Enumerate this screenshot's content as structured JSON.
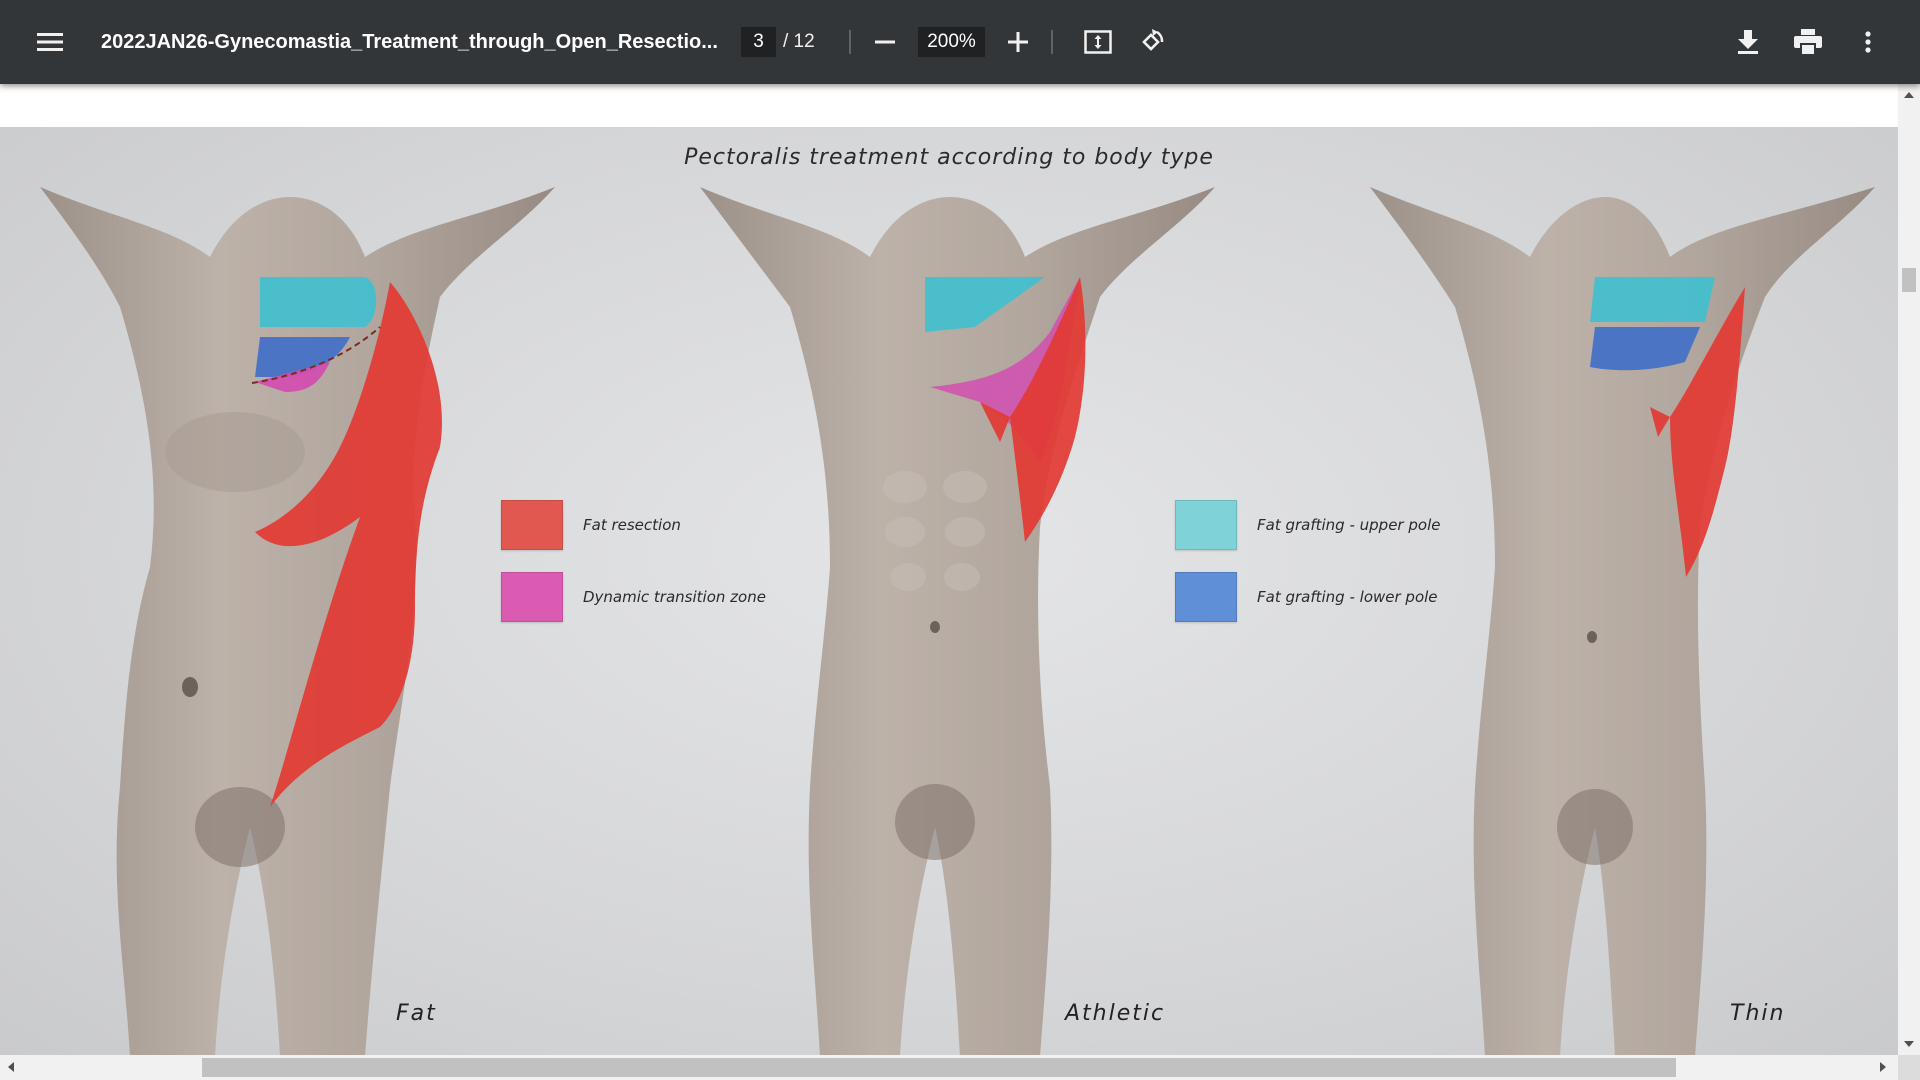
{
  "toolbar": {
    "menu_icon": "hamburger-menu-icon",
    "title": "2022JAN26-Gynecomastia_Treatment_through_Open_Resectio...",
    "current_page": "3",
    "page_total": "/ 12",
    "zoom_out_icon": "minus-icon",
    "zoom_value": "200%",
    "zoom_in_icon": "plus-icon",
    "fit_icon": "fit-to-page-icon",
    "rotate_icon": "rotate-counterclockwise-icon",
    "download_icon": "download-icon",
    "print_icon": "print-icon",
    "more_icon": "more-vert-icon"
  },
  "figure": {
    "title": "Pectoralis treatment according to body type",
    "bodies": [
      {
        "label": "Fat"
      },
      {
        "label": "Athletic"
      },
      {
        "label": "Thin"
      }
    ],
    "legend_left": [
      {
        "label": "Fat resection",
        "color": "#e0584f"
      },
      {
        "label": "Dynamic transition zone",
        "color": "#db5bb3"
      }
    ],
    "legend_right": [
      {
        "label": "Fat grafting - upper pole",
        "color": "#7fd3d8"
      },
      {
        "label": "Fat grafting - lower pole",
        "color": "#5f8fd6"
      }
    ]
  },
  "colors": {
    "toolbar_bg": "#323639",
    "viewer_bg": "#525659",
    "fat_resection": "#e23a33",
    "transition_zone": "#d24fb0",
    "upper_pole": "#3fc0d0",
    "lower_pole": "#3f6fc8",
    "skin": "#b3a89f"
  }
}
